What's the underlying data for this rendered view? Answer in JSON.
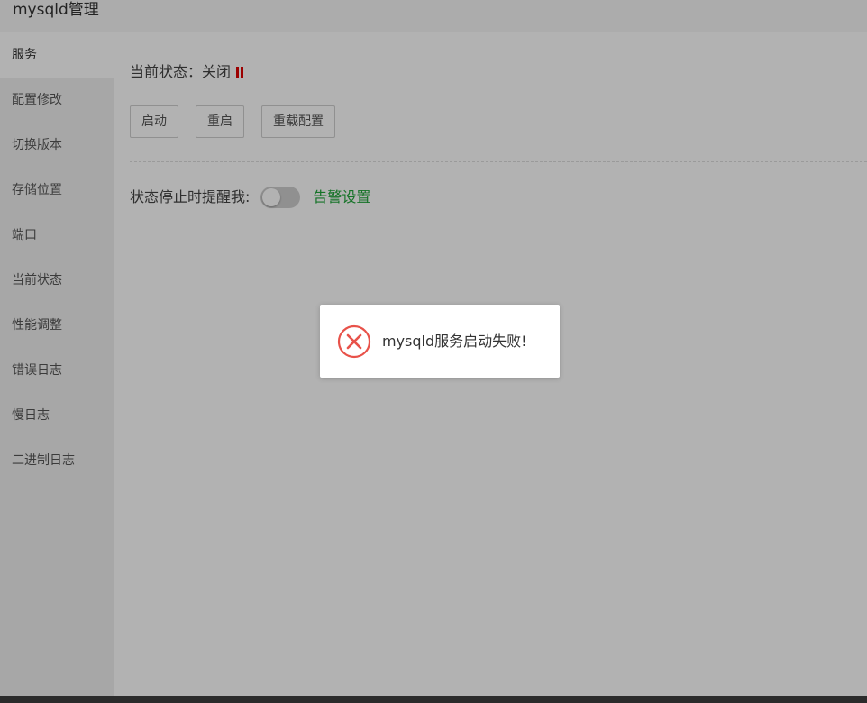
{
  "window": {
    "title": "mysqld管理"
  },
  "sidebar": {
    "items": [
      {
        "label": "服务",
        "active": true
      },
      {
        "label": "配置修改"
      },
      {
        "label": "切换版本"
      },
      {
        "label": "存储位置"
      },
      {
        "label": "端口"
      },
      {
        "label": "当前状态"
      },
      {
        "label": "性能调整"
      },
      {
        "label": "错误日志"
      },
      {
        "label": "慢日志"
      },
      {
        "label": "二进制日志"
      }
    ]
  },
  "service": {
    "status_label": "当前状态：关闭",
    "status_icon": "pause-icon",
    "status_color": "#e00000",
    "buttons": {
      "start": "启动",
      "restart": "重启",
      "reload": "重载配置"
    },
    "alert_label": "状态停止时提醒我:",
    "alert_toggle_on": false,
    "alert_link": "告警设置",
    "alert_link_color": "#20a53a"
  },
  "toast": {
    "icon": "error-icon",
    "message": "mysqld服务启动失败!",
    "icon_color": "#e8524a"
  }
}
